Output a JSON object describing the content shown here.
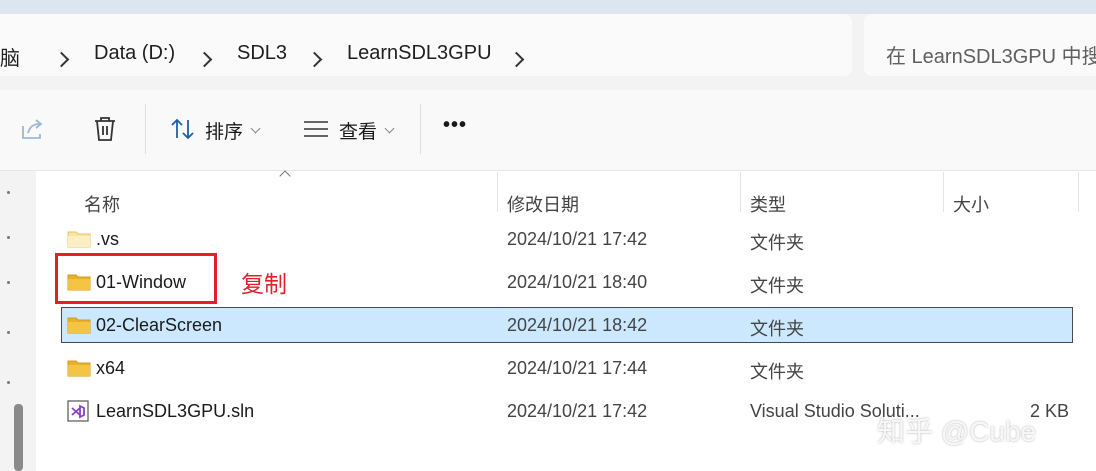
{
  "breadcrumb": {
    "items": [
      "电脑",
      "Data (D:)",
      "SDL3",
      "LearnSDL3GPU"
    ]
  },
  "search": {
    "placeholder": "在 LearnSDL3GPU 中搜"
  },
  "toolbar": {
    "share_icon": "share-icon",
    "delete_icon": "trash-icon",
    "sort_label": "排序",
    "view_label": "查看",
    "more_label": "•••"
  },
  "columns": {
    "name": "名称",
    "date": "修改日期",
    "type": "类型",
    "size": "大小"
  },
  "files": [
    {
      "name": ".vs",
      "date": "2024/10/21 17:42",
      "type": "文件夹",
      "size": "",
      "icon": "folder-icon"
    },
    {
      "name": "01-Window",
      "date": "2024/10/21 18:40",
      "type": "文件夹",
      "size": "",
      "icon": "folder-icon"
    },
    {
      "name": "02-ClearScreen",
      "date": "2024/10/21 18:42",
      "type": "文件夹",
      "size": "",
      "icon": "folder-icon",
      "selected": true
    },
    {
      "name": "x64",
      "date": "2024/10/21 17:44",
      "type": "文件夹",
      "size": "",
      "icon": "folder-icon"
    },
    {
      "name": "LearnSDL3GPU.sln",
      "date": "2024/10/21 17:42",
      "type": "Visual Studio Soluti...",
      "size": "2 KB",
      "icon": "visual-studio-solution-icon"
    }
  ],
  "annotation": {
    "text": "复制"
  },
  "watermark": {
    "text": "知乎 @Cube"
  },
  "colors": {
    "selection": "#cce8ff",
    "annotation_red": "#e0202a",
    "folder": "#f4c545"
  }
}
